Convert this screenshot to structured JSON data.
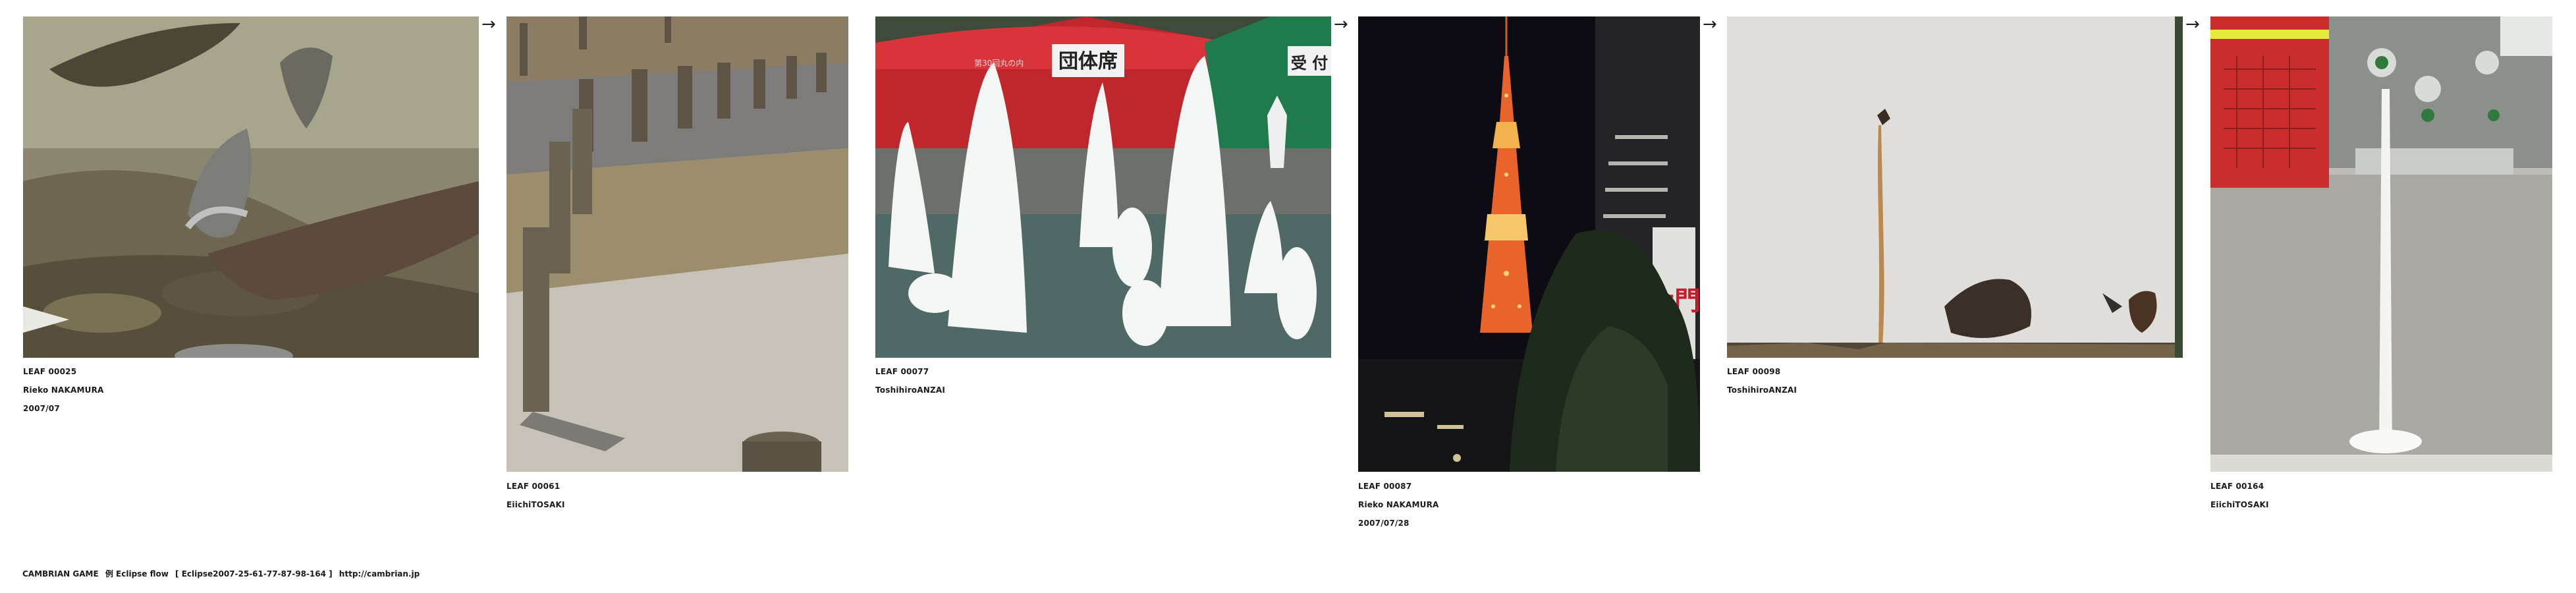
{
  "leaves": [
    {
      "id": "LEAF 00025",
      "author": "Rieko NAKAMURA",
      "date": "2007/07"
    },
    {
      "id": "LEAF 00061",
      "author": "EiichiTOSAKI",
      "date": ""
    },
    {
      "id": "LEAF 00077",
      "author": "ToshihiroANZAI",
      "date": ""
    },
    {
      "id": "LEAF 00087",
      "author": "Rieko NAKAMURA",
      "date": "2007/07/28"
    },
    {
      "id": "LEAF 00098",
      "author": "ToshihiroANZAI",
      "date": ""
    },
    {
      "id": "LEAF 00164",
      "author": "EiichiTOSAKI",
      "date": ""
    }
  ],
  "photo_text": {
    "tent_sign": "団体席",
    "tent_sign_2": "受 付",
    "tent_banner": "第30回丸の内",
    "building_sign": "大門"
  },
  "arrow_glyph": "→",
  "footer": {
    "game": "CAMBRIAN GAME",
    "title": "例 Eclipse  flow",
    "flow_code": "[ Eclipse2007-25-61-77-87-98-164 ]",
    "url": "http://cambrian.jp"
  }
}
